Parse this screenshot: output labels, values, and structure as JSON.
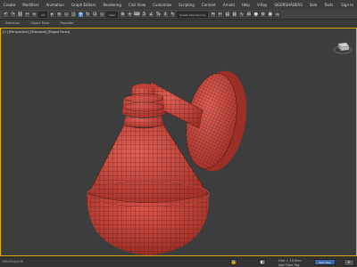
{
  "menubar": {
    "items": [
      "Create",
      "Modifiers",
      "Animation",
      "Graph Editors",
      "Rendering",
      "Civil View",
      "Customize",
      "Scripting",
      "Content",
      "Arnold",
      "Help",
      "V-Ray",
      "SIGERSHADERS",
      "Sale",
      "Tools"
    ],
    "sign_in": "Sign In"
  },
  "toolbar": {
    "selection_filter": "All",
    "view_dropdown": "View",
    "selection_set": "Create Selection Se"
  },
  "ribbon": {
    "tabs": [
      "Selection",
      "Object Paint",
      "Populate"
    ]
  },
  "viewport": {
    "label": "[+] [Perspective] [Standard] [Edged Faces]"
  },
  "model": {
    "fill": "#d0483e",
    "wire": "#4a1814",
    "rim": "#e05a4e"
  },
  "viewcube": {
    "label": "FRONT"
  },
  "status": {
    "left_text": "MAXScript Mi",
    "grid": "Grid = 10.0cm",
    "tag": "Add Time Tag",
    "auto_key": "Auto Key",
    "add_button": "+"
  },
  "colors": {
    "accent": "#e0b100",
    "viewport_bg": "#3d3d3d"
  }
}
